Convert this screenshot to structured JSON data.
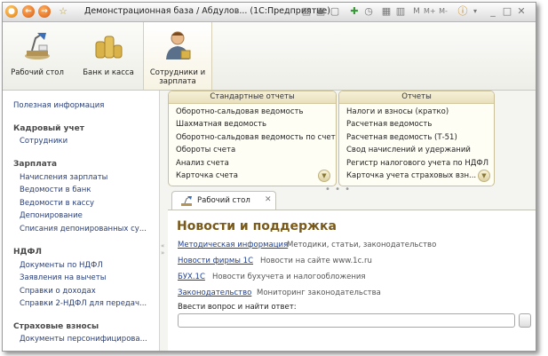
{
  "window": {
    "title": "Демонстрационная база / Абдулов... (1С:Предприятие)"
  },
  "sections": [
    {
      "label": "Рабочий стол",
      "icon": "desktop-lamp-icon"
    },
    {
      "label": "Банк и касса",
      "icon": "coins-icon"
    },
    {
      "label": "Сотрудники и зарплата",
      "icon": "employee-icon",
      "active": true
    }
  ],
  "left_nav": {
    "top_link": "Полезная информация",
    "groups": [
      {
        "title": "Кадровый учет",
        "items": [
          "Сотрудники"
        ]
      },
      {
        "title": "Зарплата",
        "items": [
          "Начисления зарплаты",
          "Ведомости в банк",
          "Ведомости в кассу",
          "Депонирование",
          "Списания депонированных су..."
        ]
      },
      {
        "title": "НДФЛ",
        "items": [
          "Документы по НДФЛ",
          "Заявления на вычеты",
          "Справки о доходах",
          "Справки 2-НДФЛ для передач..."
        ]
      },
      {
        "title": "Страховые взносы",
        "items": [
          "Документы персонифицирова..."
        ]
      }
    ]
  },
  "standard_reports": {
    "title": "Стандартные отчеты",
    "items": [
      "Оборотно-сальдовая ведомость",
      "Шахматная ведомость",
      "Оборотно-сальдовая ведомость по счету",
      "Обороты счета",
      "Анализ счета",
      "Карточка счета"
    ]
  },
  "reports": {
    "title": "Отчеты",
    "items": [
      "Налоги и взносы (кратко)",
      "Расчетная ведомость",
      "Расчетная ведомость (Т-51)",
      "Свод начислений и удержаний",
      "Регистр налогового учета по НДФЛ",
      "Карточка учета страховых взн..."
    ]
  },
  "tab": {
    "label": "Рабочий стол"
  },
  "news": {
    "title": "Новости и поддержка",
    "links": [
      {
        "label": "Методическая информация",
        "desc": "Методики, статьи, законодательство"
      },
      {
        "label": "Новости фирмы 1С",
        "desc": "Новости на сайте www.1c.ru"
      },
      {
        "label": "БУХ.1С",
        "desc": "Новости бухучета и налогообложения"
      },
      {
        "label": "Законодательство",
        "desc": "Мониторинг законодательства"
      }
    ],
    "ask_label": "Ввести вопрос и найти ответ:",
    "ask_value": ""
  },
  "colors": {
    "accent_title": "#7a5a1a",
    "link": "#1d3f9a",
    "panel_header": "#e9e0bc"
  }
}
